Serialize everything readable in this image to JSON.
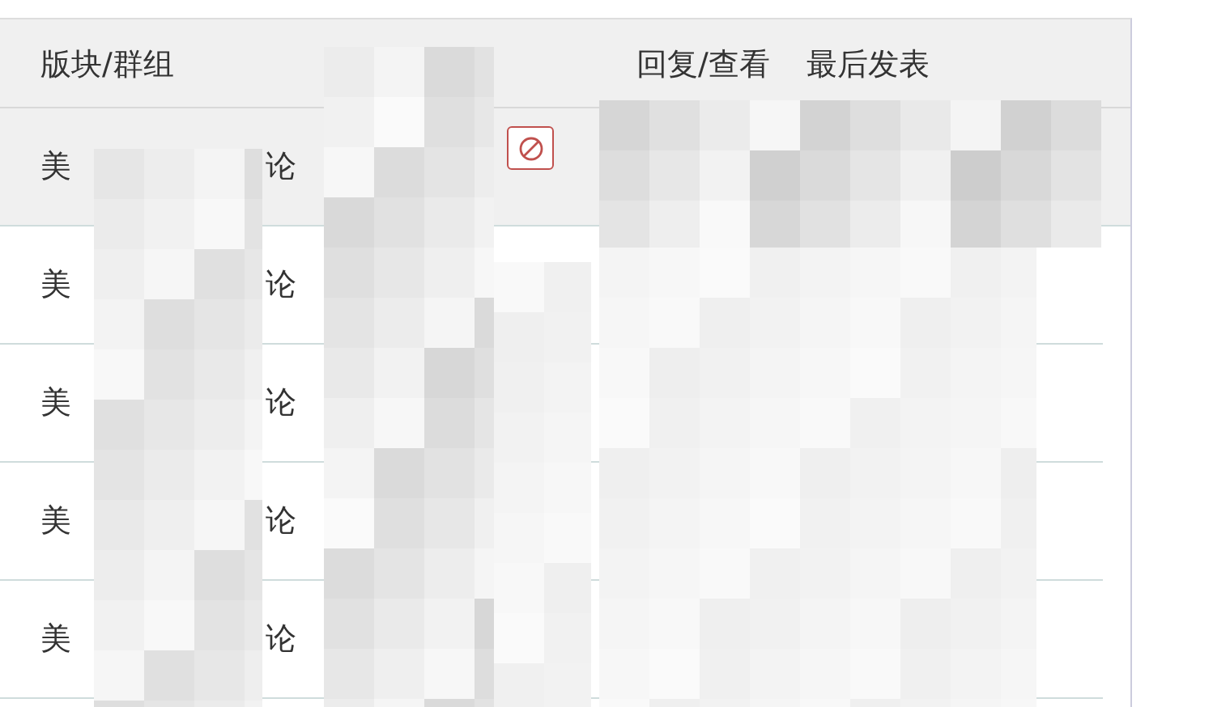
{
  "table": {
    "columns": [
      {
        "label": "版块/群组"
      },
      {
        "label": "回复/查看"
      },
      {
        "label": "最后发表"
      }
    ],
    "rows": [
      {
        "forum_start": "美",
        "forum_end": "论",
        "highlighted": true,
        "ban_icon": true
      },
      {
        "forum_start": "美",
        "forum_end": "论",
        "highlighted": false,
        "ban_icon": false
      },
      {
        "forum_start": "美",
        "forum_end": "论",
        "highlighted": false,
        "ban_icon": false
      },
      {
        "forum_start": "美",
        "forum_end": "论",
        "highlighted": false,
        "ban_icon": false
      },
      {
        "forum_start": "美",
        "forum_end": "论",
        "highlighted": false,
        "ban_icon": false
      }
    ]
  }
}
